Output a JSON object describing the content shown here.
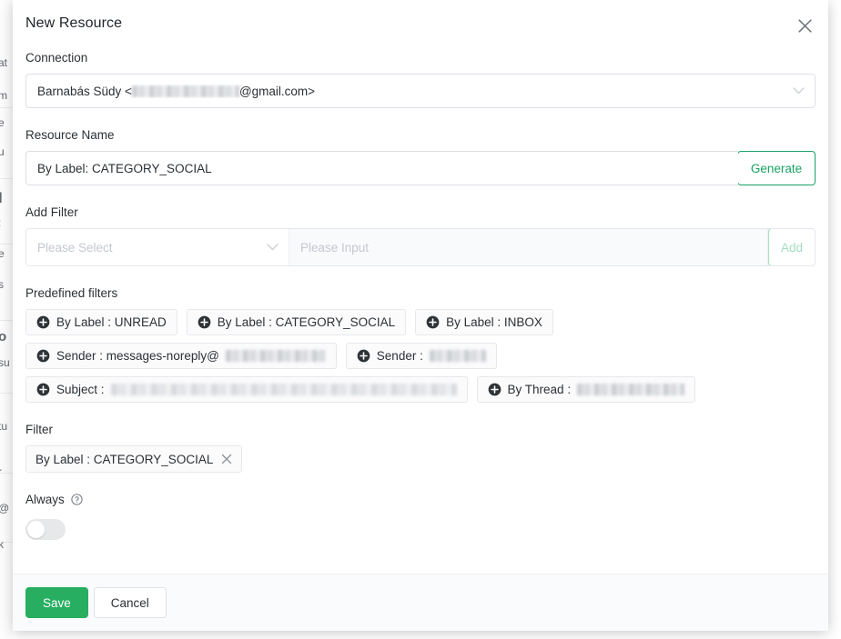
{
  "modal": {
    "title": "New Resource",
    "close_icon": "close-icon"
  },
  "connection": {
    "label": "Connection",
    "value_prefix": "Barnabás Südy <",
    "value_suffix": "@gmail.com>",
    "redacted": true,
    "chevron_icon": "chevron-down-icon"
  },
  "resource_name": {
    "label": "Resource Name",
    "value": "By Label: CATEGORY_SOCIAL",
    "generate_label": "Generate"
  },
  "add_filter": {
    "label": "Add Filter",
    "select_placeholder": "Please Select",
    "input_placeholder": "Please Input",
    "add_label": "Add",
    "add_disabled": true,
    "chevron_icon": "chevron-down-icon"
  },
  "predefined_filters": {
    "label": "Predefined filters",
    "rows": [
      [
        {
          "text": "By Label : UNREAD",
          "redacted_width": 0
        },
        {
          "text": "By Label : CATEGORY_SOCIAL",
          "redacted_width": 0
        },
        {
          "text": "By Label : INBOX",
          "redacted_width": 0
        }
      ],
      [
        {
          "text": "Sender : messages-noreply@",
          "redacted_width": 110
        },
        {
          "text": "Sender : ",
          "redacted_width": 62
        }
      ],
      [
        {
          "text": "Subject : ",
          "redacted_width": 380
        },
        {
          "text": "By Thread : ",
          "redacted_width": 118
        }
      ]
    ],
    "plus_icon": "plus-circle-icon"
  },
  "filter": {
    "label": "Filter",
    "tags": [
      {
        "text": "By Label : CATEGORY_SOCIAL",
        "close_icon": "close-icon"
      }
    ]
  },
  "always": {
    "label": "Always",
    "help_icon": "help-circle-icon",
    "toggle_on": false
  },
  "footer": {
    "save_label": "Save",
    "cancel_label": "Cancel"
  },
  "colors": {
    "accent_green": "#27ae60",
    "generate_green": "#1aa463",
    "disabled_green": "#a3ddc0",
    "overlay": "#6f7275"
  },
  "background_fragments": [
    "at",
    "m",
    "e",
    "u",
    "I",
    ":",
    "e",
    "s",
    "o",
    "su",
    "tu",
    "r",
    "@",
    "k"
  ]
}
